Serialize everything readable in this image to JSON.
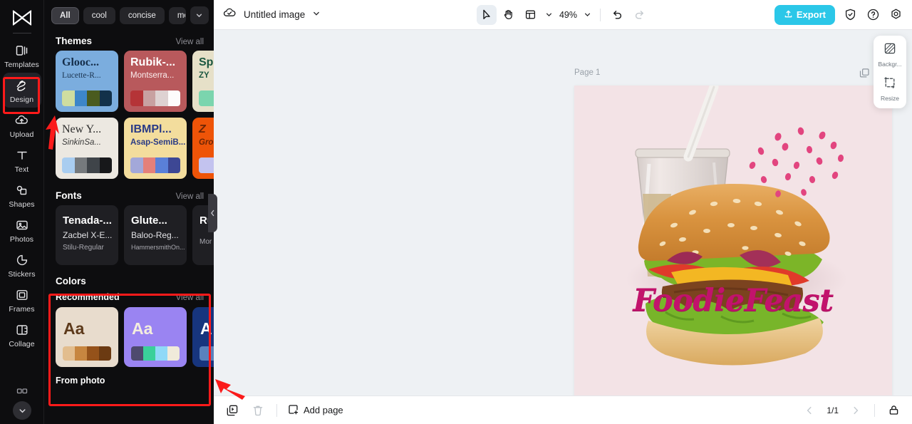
{
  "rail": {
    "logo_icon": "capcut-logo-icon",
    "items": [
      {
        "label": "Templates",
        "icon": "templates-icon",
        "active": false
      },
      {
        "label": "Design",
        "icon": "design-icon",
        "active": true
      },
      {
        "label": "Upload",
        "icon": "upload-cloud-icon",
        "active": false
      },
      {
        "label": "Text",
        "icon": "text-icon",
        "active": false
      },
      {
        "label": "Shapes",
        "icon": "shapes-icon",
        "active": false
      },
      {
        "label": "Photos",
        "icon": "photos-icon",
        "active": false
      },
      {
        "label": "Stickers",
        "icon": "stickers-icon",
        "active": false
      },
      {
        "label": "Frames",
        "icon": "frames-icon",
        "active": false
      },
      {
        "label": "Collage",
        "icon": "collage-icon",
        "active": false
      }
    ],
    "expand_icon": "chevron-down-icon"
  },
  "panel": {
    "chips": [
      {
        "label": "All",
        "selected": true
      },
      {
        "label": "cool",
        "selected": false
      },
      {
        "label": "concise",
        "selected": false
      },
      {
        "label": "modern",
        "selected": false
      }
    ],
    "chips_more_icon": "chevron-down-icon",
    "themes": {
      "title": "Themes",
      "view_all": "View all",
      "cards": [
        {
          "t1": "Glooc...",
          "t2": "Lucette-R...",
          "bg": "#7badde",
          "t1c": "#152e4a",
          "t2c": "#1b3450",
          "swatches": [
            "#cfdda0",
            "#3d86c9",
            "#4a5b1f",
            "#12314a"
          ]
        },
        {
          "t1": "Rubik-...",
          "t2": "Montserra...",
          "bg": "#b8595c",
          "t1c": "#ffffff",
          "t2c": "#fbeeee",
          "swatches": [
            "#b53437",
            "#c8a1a1",
            "#ded2d2",
            "#fdfbfb"
          ]
        },
        {
          "t1": "Sp",
          "t2": "ZY",
          "bg": "#e6e0c8",
          "t1c": "#1b5740",
          "t2c": "#1b5740",
          "swatches": [
            "#7bd5ae",
            "#7bd5ae",
            "#7bd5ae",
            "#7bd5ae"
          ]
        },
        {
          "t1": "New Y...",
          "t2": "SinkinSa...",
          "bg": "#ece8e1",
          "t1c": "#2b2b2b",
          "t2c": "#3a3a3a",
          "swatches": [
            "#a9cdf0",
            "#767a7d",
            "#3f4449",
            "#17181a"
          ]
        },
        {
          "t1": "IBMPl...",
          "t2": "Asap-SemiB...",
          "bg": "#f3dd9d",
          "t1c": "#2a3b86",
          "t2c": "#2a3b86",
          "swatches": [
            "#a3a8d9",
            "#e4807a",
            "#5a80d8",
            "#3d4794"
          ]
        },
        {
          "t1": "Z",
          "t2": "Gro",
          "bg": "#ee5408",
          "t1c": "#6d2605",
          "t2c": "#6d2605",
          "swatches": [
            "#c3c3ef",
            "#c3c3ef",
            "#c3c3ef",
            "#c3c3ef"
          ]
        }
      ],
      "next_icon": "chevron-right-icon"
    },
    "fonts": {
      "title": "Fonts",
      "view_all": "View all",
      "cards": [
        {
          "f1": "Tenada-...",
          "f2": "Zacbel X-E...",
          "f3": "Stilu-Regular"
        },
        {
          "f1": "Glute...",
          "f2": "Baloo-Reg...",
          "f3": "HammersmithOn..."
        },
        {
          "f1": "Ru",
          "f2": "",
          "f3": "Mor"
        }
      ],
      "next_icon": "chevron-right-icon"
    },
    "colors": {
      "title": "Colors",
      "recommended_label": "Recommended",
      "view_all": "View all",
      "cards": [
        {
          "aa": "Aa",
          "bg": "#e8dccd",
          "aac": "#5d3a1b",
          "swatches": [
            "#e2bd8e",
            "#c78640",
            "#95521a",
            "#6b3a12"
          ]
        },
        {
          "aa": "Aa",
          "bg": "#9a84f2",
          "aac": "#f4eede",
          "swatches": [
            "#4e4a6e",
            "#3ad09a",
            "#8fd9f7",
            "#f0eada"
          ]
        },
        {
          "aa": "A",
          "bg": "#17357e",
          "aac": "#ffffff",
          "swatches": [
            "#5a82bd",
            "#5a82bd",
            "#5a82bd",
            "#5a82bd"
          ]
        }
      ],
      "next_icon": "chevron-right-icon",
      "from_photo_label": "From photo"
    },
    "collapse_icon": "chevron-left-icon"
  },
  "topbar": {
    "cloud_icon": "cloud-saved-icon",
    "doc_title": "Untitled image",
    "title_caret_icon": "chevron-down-icon",
    "tools": [
      {
        "name": "select-tool",
        "icon": "cursor-arrow-icon",
        "selected": true
      },
      {
        "name": "hand-tool",
        "icon": "hand-icon",
        "selected": false
      },
      {
        "name": "layout-tool",
        "icon": "layout-grid-icon",
        "selected": false
      }
    ],
    "layout_caret_icon": "chevron-down-icon",
    "zoom_level": "49%",
    "zoom_caret_icon": "chevron-down-icon",
    "undo_icon": "undo-icon",
    "redo_icon": "redo-icon",
    "export_label": "Export",
    "export_icon": "export-upload-icon",
    "export_color": "#2bc7e8",
    "shield_icon": "shield-check-icon",
    "help_icon": "question-circle-icon",
    "settings_icon": "gear-icon"
  },
  "canvas": {
    "page_label": "Page 1",
    "duplicate_icon": "duplicate-page-icon",
    "more_icon": "more-horizontal-icon",
    "artboard_bg": "#f3e3e6",
    "design_title": "FoodieFeast",
    "design_title_color": "#c2136c"
  },
  "right_float": {
    "items": [
      {
        "label": "Backgr...",
        "icon": "background-icon"
      },
      {
        "label": "Resize",
        "icon": "resize-icon"
      }
    ]
  },
  "bottombar": {
    "duplicate_icon": "duplicate-icon",
    "delete_icon": "trash-icon",
    "add_page_label": "Add page",
    "add_page_icon": "add-page-icon",
    "prev_icon": "chevron-left-icon",
    "page_indicator": "1/1",
    "next_icon": "chevron-right-icon",
    "lock_icon": "lock-icon"
  },
  "annotations": {
    "highlight_color": "#ff1a1a",
    "boxes": [
      "design-rail-item",
      "colors-section"
    ],
    "arrows": [
      "arrow-to-design",
      "arrow-to-colors"
    ]
  }
}
